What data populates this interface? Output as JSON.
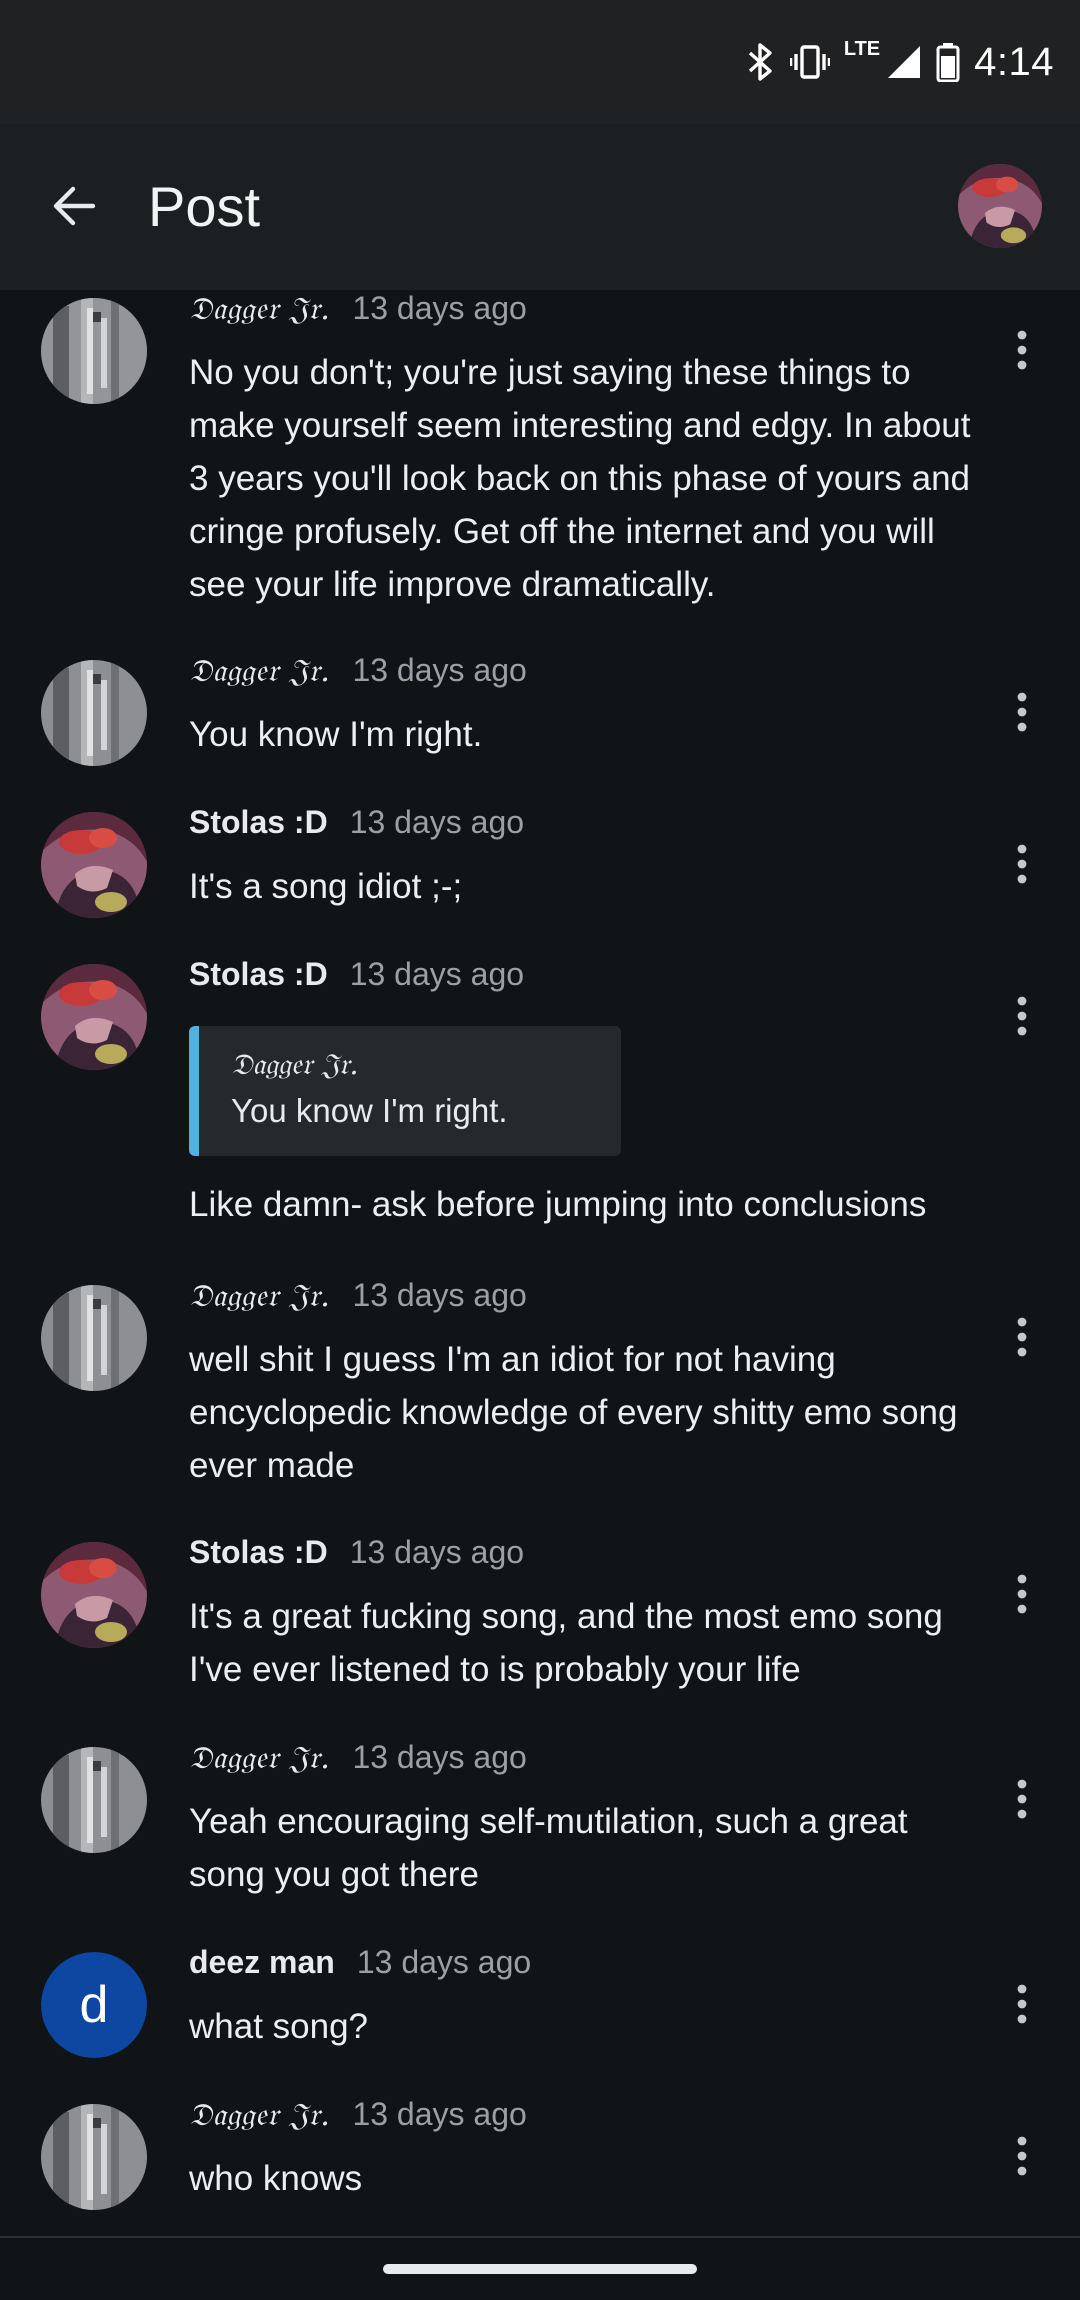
{
  "status_bar": {
    "time": "4:14",
    "network": "LTE",
    "icons": [
      "bluetooth-icon",
      "vibrate-icon",
      "signal-icon",
      "battery-icon"
    ]
  },
  "app_bar": {
    "title": "Post",
    "back_icon": "arrow-back-icon"
  },
  "comments": [
    {
      "author": "𝔇𝔞𝔤𝔤𝔢𝔯 𝔍𝔯.",
      "time": "13 days ago",
      "text": "No you don't; you're just saying these things to make yourself seem interesting and edgy. In about 3 years you'll look back on this phase of yours and cringe profusely. Get off the internet and you will see your life improve dramatically."
    },
    {
      "author": "𝔇𝔞𝔤𝔤𝔢𝔯 𝔍𝔯.",
      "time": "13 days ago",
      "text": "You know I'm right."
    },
    {
      "author": "Stolas :D",
      "time": "13 days ago",
      "text": "It's a song idiot ;-;"
    },
    {
      "author": "Stolas :D",
      "time": "13 days ago",
      "quote": {
        "author": "𝔇𝔞𝔤𝔤𝔢𝔯 𝔍𝔯.",
        "text": "You know I'm right."
      },
      "text": "Like damn- ask before jumping into conclusions"
    },
    {
      "author": "𝔇𝔞𝔤𝔤𝔢𝔯 𝔍𝔯.",
      "time": "13 days ago",
      "text": "well shit I guess I'm an idiot for not having encyclopedic knowledge of every shitty emo song ever made"
    },
    {
      "author": "Stolas :D",
      "time": "13 days ago",
      "text": "It's a great fucking song, and the most emo song I've ever listened to is probably your life"
    },
    {
      "author": "𝔇𝔞𝔤𝔤𝔢𝔯 𝔍𝔯.",
      "time": "13 days ago",
      "text": "Yeah encouraging self-mutilation, such a great song you got there"
    },
    {
      "author": "deez man",
      "time": "13 days ago",
      "avatar_letter": "d",
      "text": "what song?"
    },
    {
      "author": "𝔇𝔞𝔤𝔤𝔢𝔯 𝔍𝔯.",
      "time": "13 days ago",
      "text": "who knows"
    }
  ],
  "colors": {
    "background": "#111417",
    "app_bar": "#1c1f21",
    "status_bar": "#202122",
    "quote_accent": "#4fb3e0",
    "letter_avatar": "#0d47a1"
  }
}
